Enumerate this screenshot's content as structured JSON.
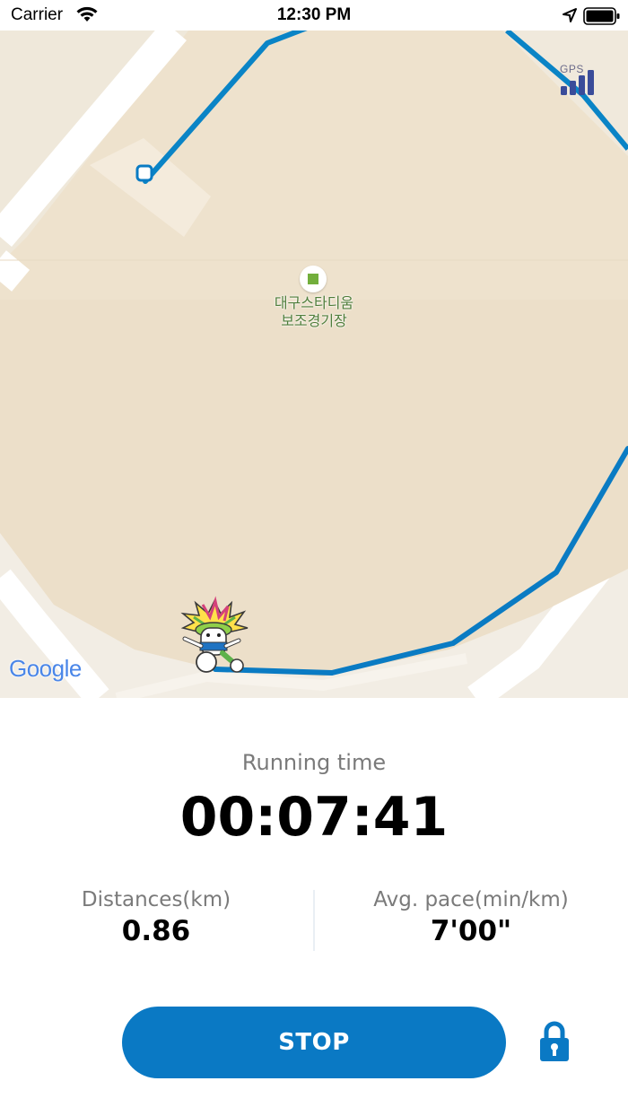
{
  "status_bar": {
    "carrier": "Carrier",
    "time": "12:30 PM"
  },
  "map": {
    "poi_label_line1": "대구스타디움",
    "poi_label_line2": "보조경기장",
    "gps_label": "GPS",
    "gps_signal_bars": 4,
    "attribution": "Google",
    "route_color": "#0a79c4",
    "icons": [
      "location-pin-icon",
      "gps-signal-icon",
      "runner-mascot-icon"
    ]
  },
  "stats": {
    "running_time_label": "Running time",
    "running_time_value": "00:07:41",
    "distance_label": "Distances(km)",
    "distance_value": "0.86",
    "pace_label": "Avg. pace(min/km)",
    "pace_value": "7'00\""
  },
  "controls": {
    "stop_label": "STOP",
    "stop_color": "#0a79c4",
    "lock_icon": "lock-icon"
  }
}
